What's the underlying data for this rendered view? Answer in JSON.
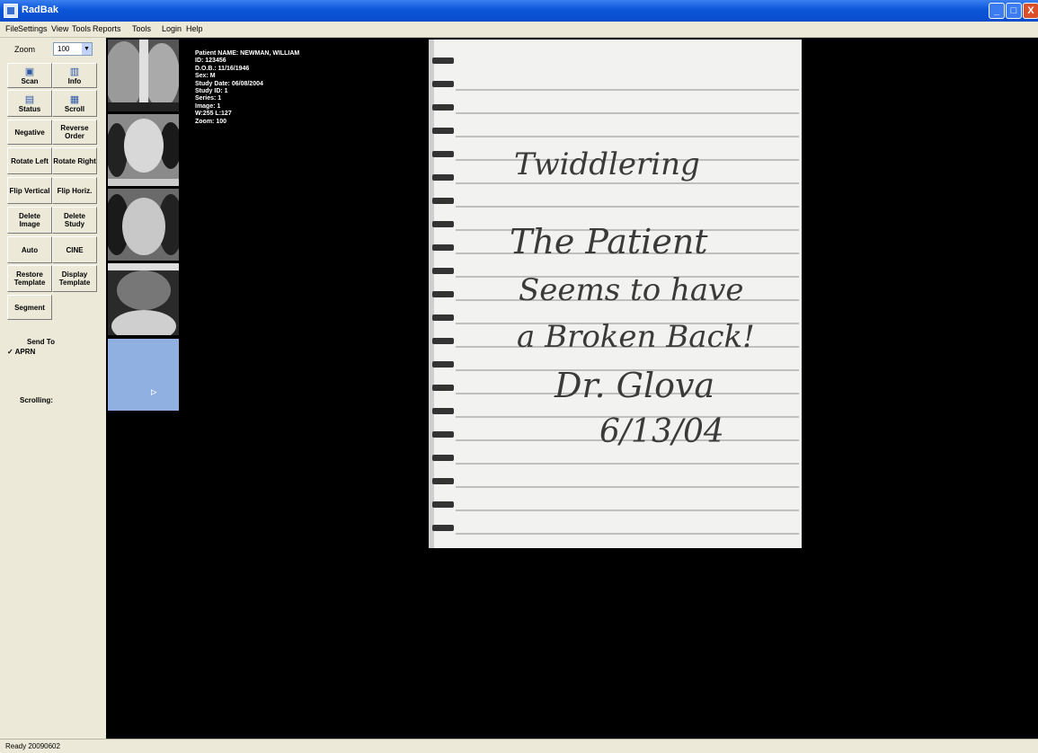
{
  "window": {
    "title": "RadBak",
    "min_glyph": "_",
    "max_glyph": "□",
    "close_glyph": "X"
  },
  "menu": [
    "File",
    "Settings",
    "View",
    "Tools",
    "Reports",
    "Tools",
    "Login",
    "Help"
  ],
  "toolbar": {
    "zoom_label": "Zoom",
    "zoom_value": "100",
    "zoom_arrow": "▼",
    "buttons": [
      {
        "label": "Scan",
        "icon": "scan-icon",
        "glyph": "▣"
      },
      {
        "label": "Info",
        "icon": "info-icon",
        "glyph": "▥"
      },
      {
        "label": "Status",
        "icon": "status-icon",
        "glyph": "▤"
      },
      {
        "label": "Scroll",
        "icon": "scroll-icon",
        "glyph": "▦"
      },
      {
        "label": "Negative"
      },
      {
        "label": "Reverse Order"
      },
      {
        "label": "Rotate Left"
      },
      {
        "label": "Rotate Right"
      },
      {
        "label": "Flip Vertical"
      },
      {
        "label": "Flip Horiz."
      },
      {
        "label": "Delete Image"
      },
      {
        "label": "Delete Study"
      },
      {
        "label": "Auto"
      },
      {
        "label": "CINE"
      },
      {
        "label": "Restore Template"
      },
      {
        "label": "Display Template"
      },
      {
        "label": "Segment"
      }
    ],
    "send_to_label": "Send To",
    "send_to_item": "✓ APRN",
    "scrolling_label": "Scrolling:"
  },
  "study_info": [
    "Patient NAME: NEWMAN, WILLIAM",
    "ID: 123456",
    "D.O.B.: 11/16/1946",
    "Sex: M",
    "Study Date: 06/08/2004",
    "Study ID: 1",
    "Series: 1",
    "Image: 1",
    "W:255 L:127",
    "Zoom: 100"
  ],
  "note": {
    "line1": "Twiddlering",
    "line2": "The Patient",
    "line3": "Seems to have",
    "line4": "a Broken Back!",
    "signature": "Dr. Glova",
    "date": "6/13/04"
  },
  "status": {
    "text": "Ready  20090602"
  }
}
